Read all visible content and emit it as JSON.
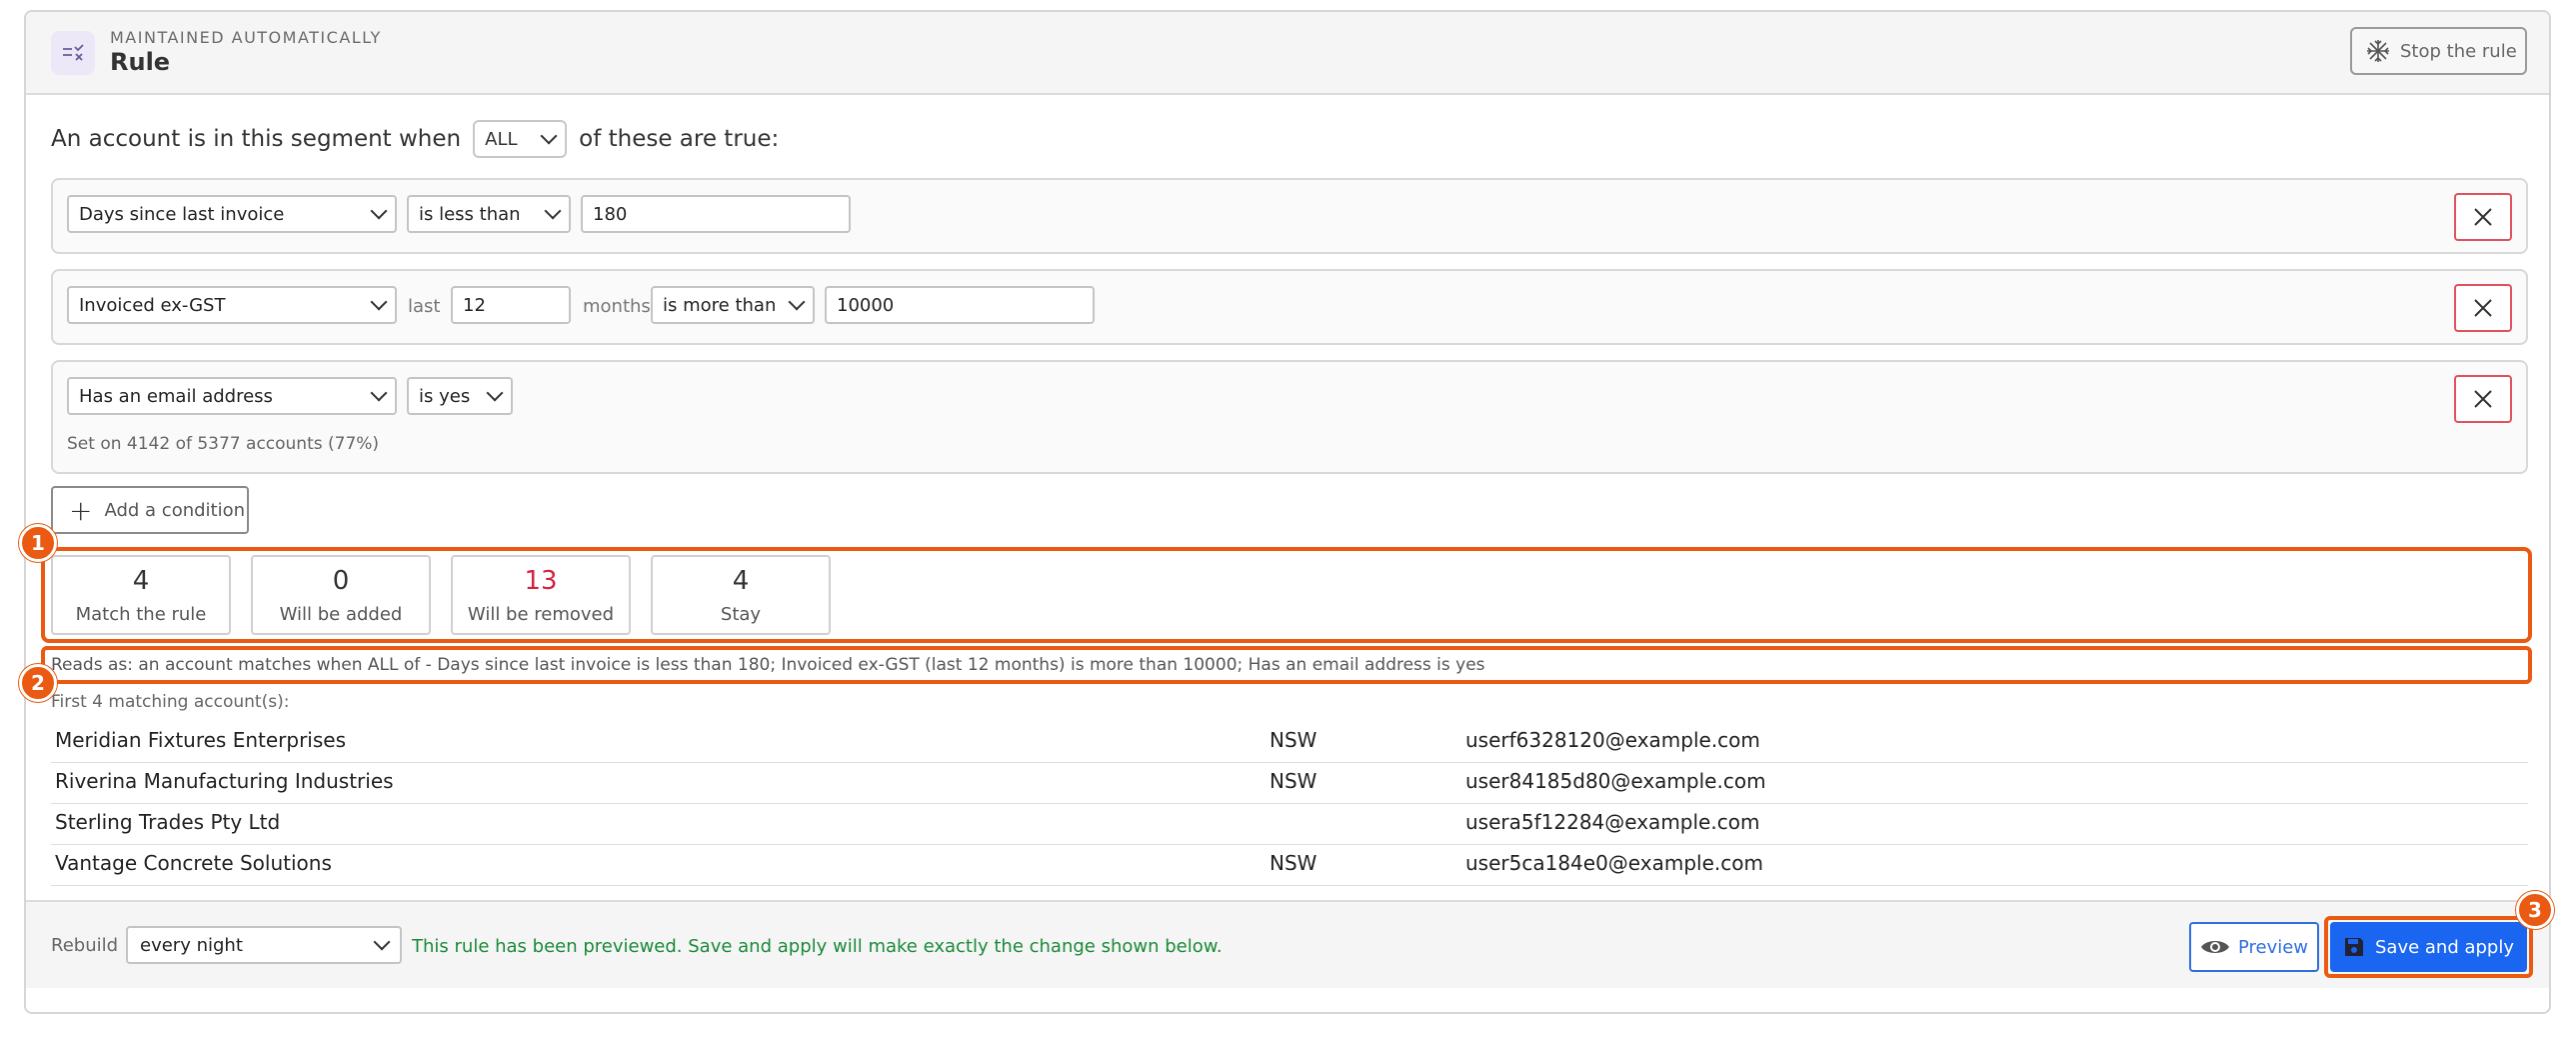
{
  "header": {
    "kicker": "MAINTAINED AUTOMATICALLY",
    "title": "Rule",
    "stop_label": "Stop the rule"
  },
  "intro": {
    "prefix": "An account is in this segment when",
    "match_mode": "ALL",
    "suffix": "of these are true:"
  },
  "conditions": [
    {
      "field": "Days since last invoice",
      "operator": "is less than",
      "value": "180"
    },
    {
      "field": "Invoiced ex-GST",
      "last_label": "last",
      "period_value": "12",
      "period_unit": "months",
      "operator": "is more than",
      "value": "10000"
    },
    {
      "field": "Has an email address",
      "operator": "is yes",
      "note": "Set on 4142 of 5377 accounts (77%)"
    }
  ],
  "add_condition_label": "Add a condition",
  "stats": [
    {
      "value": "4",
      "caption": "Match the rule"
    },
    {
      "value": "0",
      "caption": "Will be added"
    },
    {
      "value": "13",
      "caption": "Will be removed"
    },
    {
      "value": "4",
      "caption": "Stay"
    }
  ],
  "reads_as": "Reads as: an account matches when ALL of - Days since last invoice is less than 180; Invoiced ex-GST (last 12 months) is more than 10000; Has an email address is yes",
  "matching_label": "First 4 matching account(s):",
  "accounts": [
    {
      "name": "Meridian Fixtures Enterprises",
      "state": "NSW",
      "email": "userf6328120@example.com"
    },
    {
      "name": "Riverina Manufacturing Industries",
      "state": "NSW",
      "email": "user84185d80@example.com"
    },
    {
      "name": "Sterling Trades Pty Ltd",
      "state": "",
      "email": "usera5f12284@example.com"
    },
    {
      "name": "Vantage Concrete Solutions",
      "state": "NSW",
      "email": "user5ca184e0@example.com"
    }
  ],
  "footer": {
    "rebuild_label": "Rebuild",
    "rebuild_value": "every night",
    "status_message": "This rule has been previewed. Save and apply will make exactly the change shown below.",
    "preview_label": "Preview",
    "save_label": "Save and apply"
  },
  "badges": [
    "1",
    "2",
    "3"
  ],
  "colors": {
    "accent": "#1a66f0",
    "highlight": "#ea5a12",
    "danger": "#d42341",
    "success": "#1b8a3a"
  }
}
